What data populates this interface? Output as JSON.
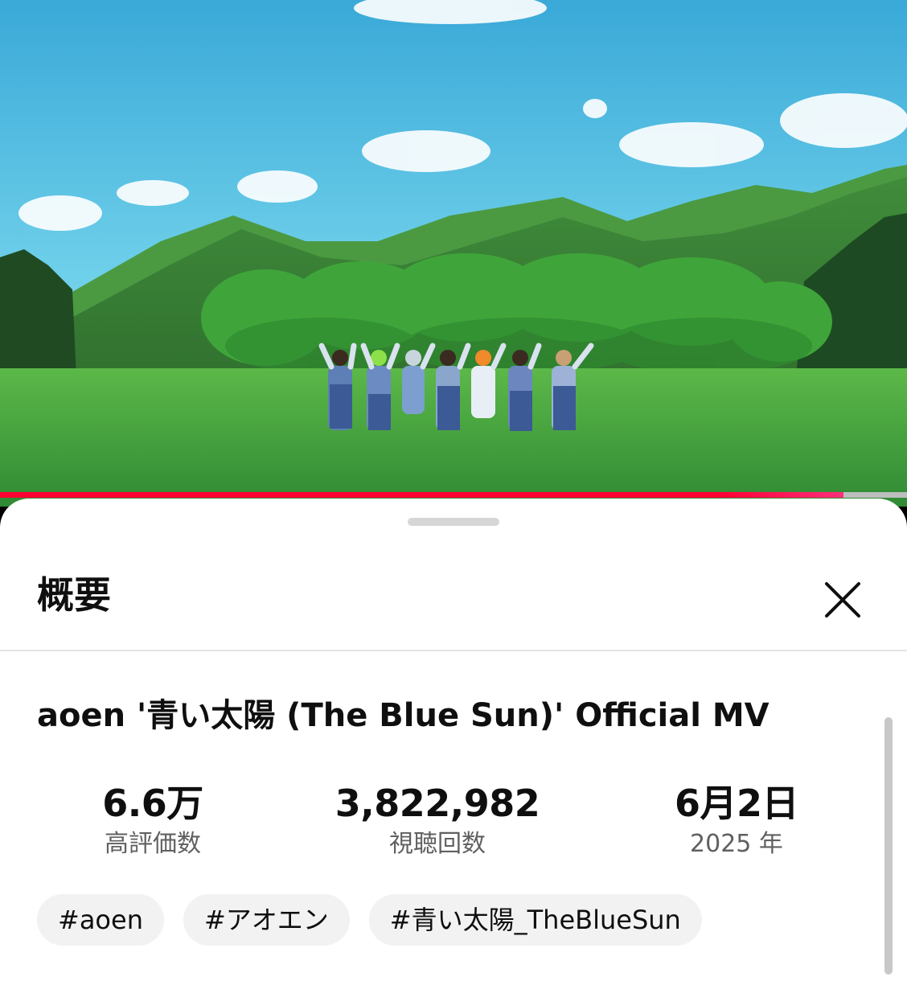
{
  "player": {
    "progress": 0.93
  },
  "sheet": {
    "title": "概要",
    "close_icon": "close-icon"
  },
  "video": {
    "title": "aoen '青い太陽 (The Blue Sun)' Official MV"
  },
  "stats": {
    "likes": {
      "value": "6.6万",
      "label": "高評価数"
    },
    "views": {
      "value": "3,822,982",
      "label": "視聴回数"
    },
    "date": {
      "value": "6月2日",
      "label": "2025 年"
    }
  },
  "tags": [
    "#aoen",
    "#アオエン",
    "#青い太陽_TheBlueSun"
  ],
  "colors": {
    "progress_red": "#ff0033",
    "sky": "#5cc6e8",
    "grass": "#3fa33d"
  }
}
